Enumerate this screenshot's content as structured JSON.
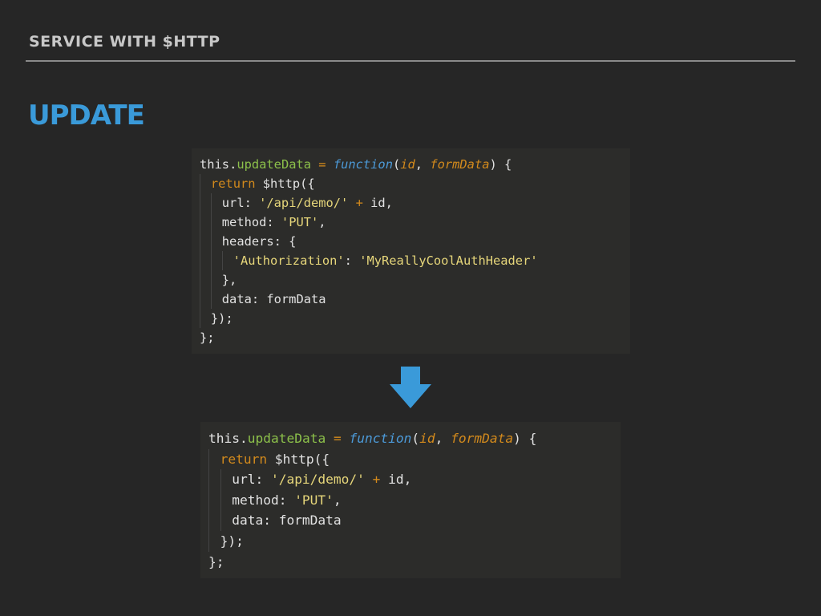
{
  "header": {
    "title": "SERVICE WITH $HTTP"
  },
  "slide": {
    "heading": "UPDATE"
  },
  "colors": {
    "background": "#262626",
    "accent": "#3a9ad9",
    "code_background": "#2c2c2a"
  },
  "icons": {
    "transition": "arrow-down-icon"
  },
  "code_before": {
    "lines": [
      [
        {
          "t": "this.",
          "c": "plain"
        },
        {
          "t": "updateData",
          "c": "prop"
        },
        {
          "t": " = ",
          "c": "op"
        },
        {
          "t": "function",
          "c": "fn"
        },
        {
          "t": "(",
          "c": "plain"
        },
        {
          "t": "id",
          "c": "param"
        },
        {
          "t": ", ",
          "c": "plain"
        },
        {
          "t": "formData",
          "c": "param"
        },
        {
          "t": ") {",
          "c": "plain"
        }
      ],
      [
        {
          "t": "return",
          "c": "kw"
        },
        {
          "t": " $http({",
          "c": "plain"
        }
      ],
      [
        {
          "t": "url: ",
          "c": "plain"
        },
        {
          "t": "'/api/demo/'",
          "c": "str"
        },
        {
          "t": " + ",
          "c": "op"
        },
        {
          "t": "id,",
          "c": "plain"
        }
      ],
      [
        {
          "t": "method: ",
          "c": "plain"
        },
        {
          "t": "'PUT'",
          "c": "str"
        },
        {
          "t": ",",
          "c": "plain"
        }
      ],
      [
        {
          "t": "headers: {",
          "c": "plain"
        }
      ],
      [
        {
          "t": "'Authorization'",
          "c": "str"
        },
        {
          "t": ": ",
          "c": "plain"
        },
        {
          "t": "'MyReallyCoolAuthHeader'",
          "c": "str"
        }
      ],
      [
        {
          "t": "},",
          "c": "plain"
        }
      ],
      [
        {
          "t": "data: formData",
          "c": "plain"
        }
      ],
      [
        {
          "t": "});",
          "c": "plain"
        }
      ],
      [
        {
          "t": "};",
          "c": "plain"
        }
      ]
    ],
    "indents": [
      0,
      1,
      2,
      2,
      2,
      3,
      2,
      2,
      1,
      0
    ]
  },
  "code_after": {
    "lines": [
      [
        {
          "t": "this.",
          "c": "plain"
        },
        {
          "t": "updateData",
          "c": "prop"
        },
        {
          "t": " = ",
          "c": "op"
        },
        {
          "t": "function",
          "c": "fn"
        },
        {
          "t": "(",
          "c": "plain"
        },
        {
          "t": "id",
          "c": "param"
        },
        {
          "t": ", ",
          "c": "plain"
        },
        {
          "t": "formData",
          "c": "param"
        },
        {
          "t": ") {",
          "c": "plain"
        }
      ],
      [
        {
          "t": "return",
          "c": "kw"
        },
        {
          "t": " $http({",
          "c": "plain"
        }
      ],
      [
        {
          "t": "url: ",
          "c": "plain"
        },
        {
          "t": "'/api/demo/'",
          "c": "str"
        },
        {
          "t": " + ",
          "c": "op"
        },
        {
          "t": "id,",
          "c": "plain"
        }
      ],
      [
        {
          "t": "method: ",
          "c": "plain"
        },
        {
          "t": "'PUT'",
          "c": "str"
        },
        {
          "t": ",",
          "c": "plain"
        }
      ],
      [
        {
          "t": "data: formData",
          "c": "plain"
        }
      ],
      [
        {
          "t": "});",
          "c": "plain"
        }
      ],
      [
        {
          "t": "};",
          "c": "plain"
        }
      ]
    ],
    "indents": [
      0,
      1,
      2,
      2,
      2,
      1,
      0
    ]
  }
}
